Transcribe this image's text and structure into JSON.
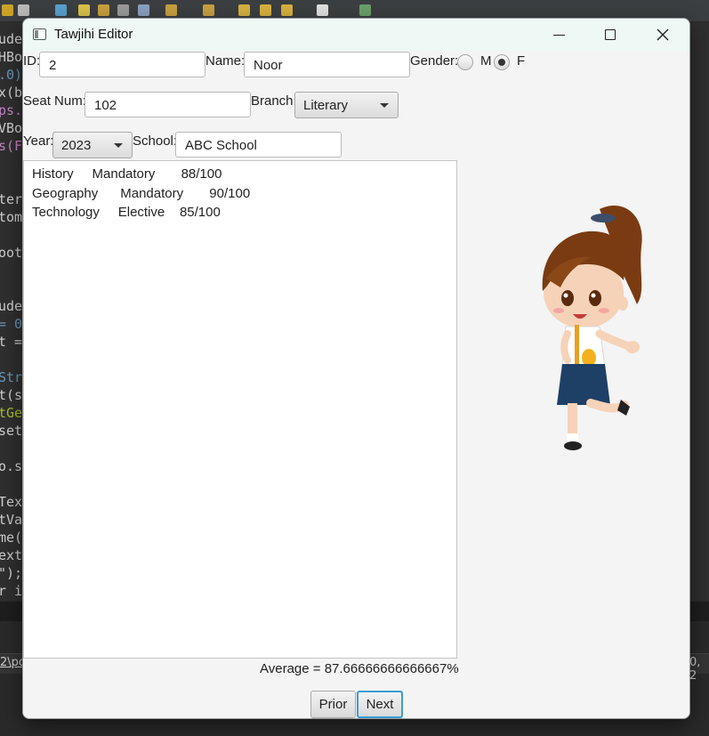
{
  "window": {
    "title": "Tawjihi Editor"
  },
  "form": {
    "id_label": "ID:",
    "id_value": "2",
    "name_label": "Name:",
    "name_value": "Noor",
    "gender_label": "Gender:",
    "gender_options": [
      "M",
      "F"
    ],
    "gender_selected": "F",
    "seat_label": "Seat Num:",
    "seat_value": "102",
    "branch_label": "Branch:",
    "branch_value": "Literary",
    "year_label": "Year:",
    "year_value": "2023",
    "school_label": "School:",
    "school_value": "ABC School"
  },
  "subjects": [
    {
      "name": "History",
      "type": "Mandatory",
      "mark": "88/100"
    },
    {
      "name": "Geography",
      "type": "Mandatory",
      "mark": "90/100"
    },
    {
      "name": "Technology",
      "type": "Elective",
      "mark": "85/100"
    }
  ],
  "average_text": "Average = 87.66666666666667%",
  "buttons": {
    "prior": "Prior",
    "next": "Next"
  },
  "background_ide": {
    "code_fragments": [
      "ude",
      "HBo",
      ".0)",
      "x(b",
      "ps.",
      "VBo",
      "s(F",
      "ter",
      "tom",
      "oot",
      "ude",
      "= 0",
      "t =",
      "Str",
      "t(s",
      "tGe",
      "set",
      "o.s",
      "Tex",
      "tVa",
      "me(",
      "ext",
      "\");",
      "r i"
    ],
    "bottom_left": "2\\po",
    "bottom_right": "0, 2"
  }
}
